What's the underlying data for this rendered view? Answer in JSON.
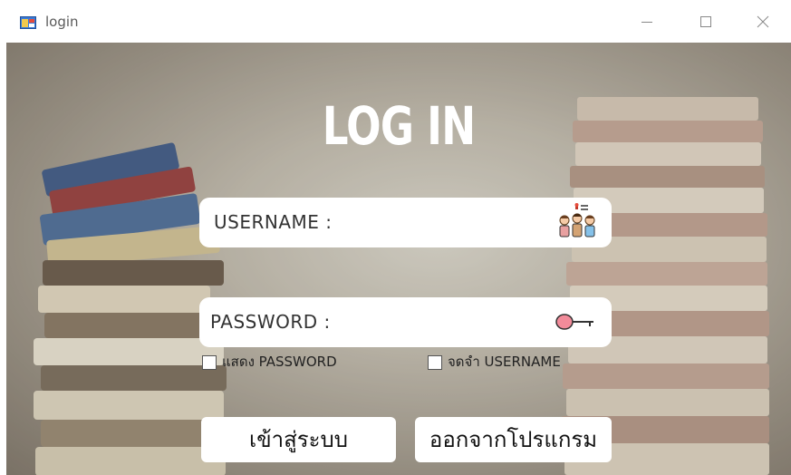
{
  "window": {
    "title": "login",
    "icon": "form-window-icon",
    "controls": {
      "minimize": "minimize-icon",
      "maximize": "maximize-icon",
      "close": "close-icon"
    }
  },
  "heading": "LOG IN",
  "username": {
    "label": "USERNAME :",
    "icon": "users-icon"
  },
  "password": {
    "label": "PASSWORD :",
    "icon": "key-icon"
  },
  "options": {
    "show_password": {
      "label": "แสดง PASSWORD",
      "checked": false
    },
    "remember_username": {
      "label": "จดจำ USERNAME",
      "checked": false
    }
  },
  "buttons": {
    "login": "เข้าสู่ระบบ",
    "exit": "ออกจากโปรแกรม"
  }
}
